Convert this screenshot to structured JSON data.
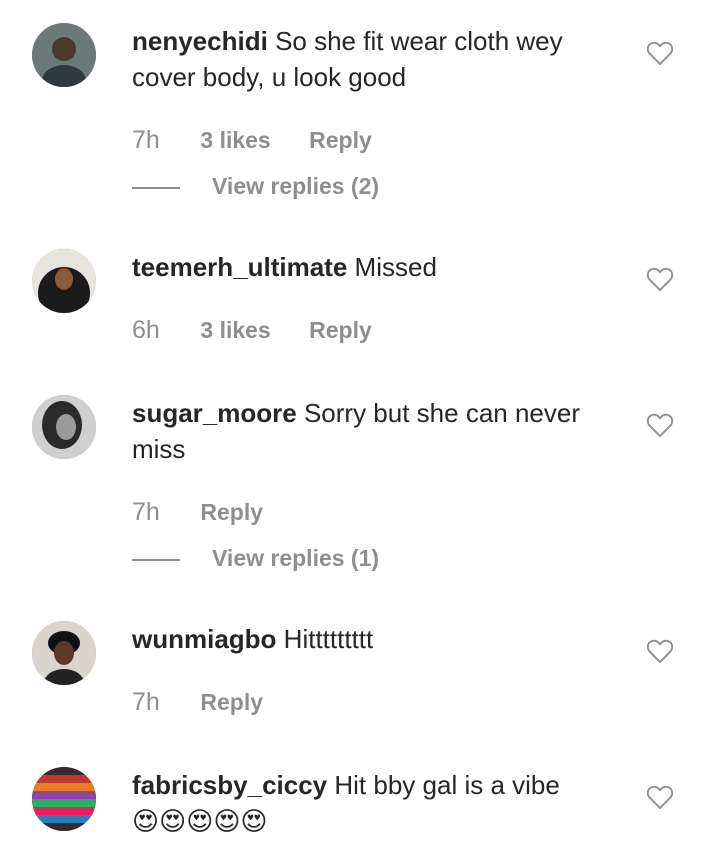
{
  "comments": [
    {
      "username": "nenyechidi",
      "text": "So she fit wear cloth wey cover body, u look good",
      "time": "7h",
      "likes": "3 likes",
      "reply_label": "Reply",
      "view_replies": "View replies (2)"
    },
    {
      "username": "teemerh_ultimate",
      "text": "Missed",
      "time": "6h",
      "likes": "3 likes",
      "reply_label": "Reply"
    },
    {
      "username": "sugar_moore",
      "text": "Sorry but she can never miss",
      "time": "7h",
      "reply_label": "Reply",
      "view_replies": "View replies (1)"
    },
    {
      "username": "wunmiagbo",
      "text": "Hittttttttt",
      "time": "7h",
      "reply_label": "Reply"
    },
    {
      "username": "fabricsby_ciccy",
      "text": "Hit bby gal is a vibe",
      "emoji": "😍😍😍😍😍"
    }
  ]
}
